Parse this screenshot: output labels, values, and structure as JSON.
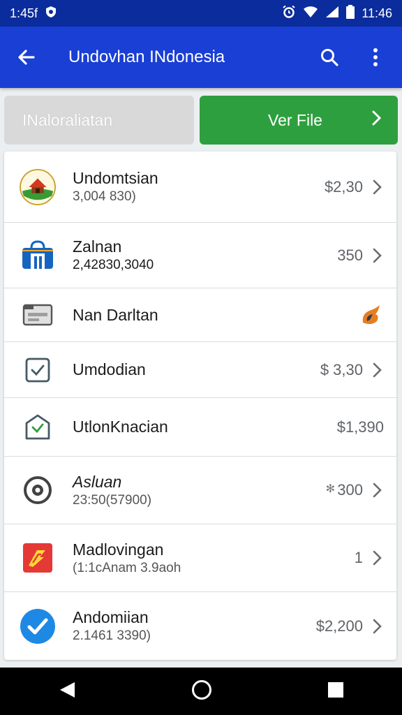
{
  "status_bar": {
    "time_left": "1:45f",
    "time_right": "11:46"
  },
  "app_bar": {
    "title": "Undovhan INdonesia"
  },
  "tabs": {
    "inactive_label": "INaloraliatan",
    "active_label": "Ver File"
  },
  "items": [
    {
      "title": "Undomtsian",
      "subtitle": "3,004 830)",
      "value": "$2,30",
      "icon": "house-badge-icon"
    },
    {
      "title": "Zalnan",
      "subtitle": "2,42830,3040",
      "value": "350",
      "icon": "shopping-bag-icon"
    },
    {
      "title": "Nan Darltan",
      "subtitle": "",
      "value": "",
      "icon": "card-reader-icon"
    },
    {
      "title": "Umdodian",
      "subtitle": "",
      "value": "$ 3,30",
      "icon": "checkbox-icon"
    },
    {
      "title": "UtlonKnacian",
      "subtitle": "",
      "value": "$1,390",
      "icon": "shield-check-icon"
    },
    {
      "title": "Asluan",
      "subtitle": "23:50(57900)",
      "value": "300",
      "icon": "settings-ring-icon"
    },
    {
      "title": "Madlovingan",
      "subtitle": "(1:1cAnam 3.9aoh",
      "value": "1",
      "icon": "brand-app-icon"
    },
    {
      "title": "Andomiian",
      "subtitle": "2.1461 3390)",
      "value": "$2,200",
      "icon": "check-circle-icon"
    }
  ],
  "colors": {
    "status_bar": "#0b2c9c",
    "app_bar": "#1a3fd4",
    "active_tab": "#2e9f3e",
    "inactive_tab": "#d9d9d9"
  }
}
